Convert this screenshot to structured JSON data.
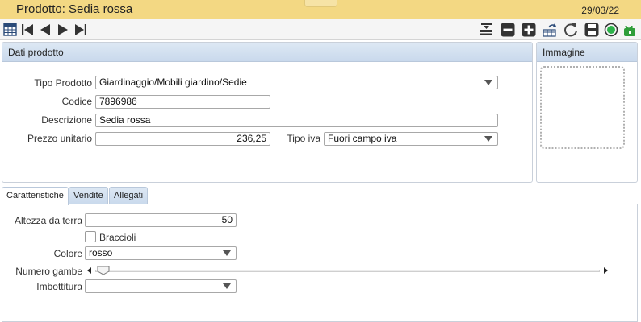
{
  "window": {
    "title": "Prodotto: Sedia rossa",
    "date": "29/03/22"
  },
  "toolbar": {
    "left": [
      "table-grid-icon",
      "first-record-icon",
      "previous-record-icon",
      "next-record-icon",
      "last-record-icon"
    ],
    "right": [
      "insert-icon",
      "delete-icon",
      "new-icon",
      "reorder-icon",
      "refresh-icon",
      "save-icon",
      "status-dot-icon",
      "unlock-icon"
    ]
  },
  "dati_prodotto": {
    "header": "Dati prodotto",
    "tipo_prodotto": {
      "label": "Tipo Prodotto",
      "value": "Giardinaggio/Mobili giardino/Sedie"
    },
    "codice": {
      "label": "Codice",
      "value": "7896986"
    },
    "descrizione": {
      "label": "Descrizione",
      "value": "Sedia rossa"
    },
    "prezzo_unitario": {
      "label": "Prezzo unitario",
      "value": "236,25"
    },
    "tipo_iva": {
      "label": "Tipo iva",
      "value": "Fuori campo iva"
    }
  },
  "immagine": {
    "header": "Immagine"
  },
  "tabs": [
    {
      "label": "Caratteristiche",
      "active": true
    },
    {
      "label": "Vendite",
      "active": false
    },
    {
      "label": "Allegati",
      "active": false
    }
  ],
  "caratteristiche": {
    "altezza": {
      "label": "Altezza da terra",
      "value": "50"
    },
    "braccioli": {
      "label": "Braccioli",
      "checked": false
    },
    "colore": {
      "label": "Colore",
      "value": "rosso"
    },
    "numero_gambe": {
      "label": "Numero gambe",
      "value": 0
    },
    "imbottitura": {
      "label": "Imbottitura",
      "value": ""
    }
  },
  "colors": {
    "titlebar": "#f3d883",
    "panel_header": "#c9d9ec",
    "status_green": "#2db24a",
    "lock_green": "#2f9e3a"
  }
}
